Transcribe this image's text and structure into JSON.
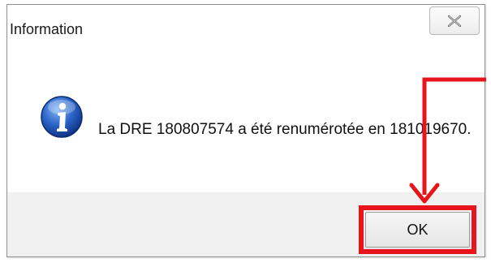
{
  "window": {
    "title": "Information",
    "close_label": "Close"
  },
  "dialog": {
    "message": "La DRE 180807574 a été renumérotée en 181019670.",
    "icon": "info-icon",
    "ok_label": "OK"
  },
  "annotation": {
    "highlight_color": "#e8141c"
  }
}
